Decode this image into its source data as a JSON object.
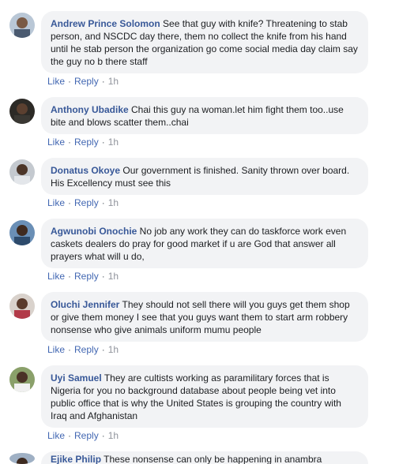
{
  "comments": [
    {
      "author": "Andrew Prince Solomon",
      "text": "See that guy with knife? Threatening to stab person, and NSCDC day there, them no collect the knife from his hand until he stab person the organization go come social media day claim say the guy no b there staff",
      "like": "Like",
      "reply": "Reply",
      "time": "1h"
    },
    {
      "author": "Anthony Ubadike",
      "text": "Chai this guy na woman.let him fight them too..use bite and blows scatter them..chai",
      "like": "Like",
      "reply": "Reply",
      "time": "1h"
    },
    {
      "author": "Donatus Okoye",
      "text": "Our government is finished. Sanity thrown over board. His Excellency must see this",
      "like": "Like",
      "reply": "Reply",
      "time": "1h"
    },
    {
      "author": "Agwunobi Onochie",
      "text": "No job any work they can do taskforce work even caskets dealers do pray for good market if u are God that answer all prayers what will u do,",
      "like": "Like",
      "reply": "Reply",
      "time": "1h"
    },
    {
      "author": "Oluchi Jennifer",
      "text": "They should not sell there will you guys get them shop or give them money I see that you guys want them to start arm robbery nonsense who give animals uniform mumu people",
      "like": "Like",
      "reply": "Reply",
      "time": "1h"
    },
    {
      "author": "Uyi Samuel",
      "text": "They are cultists working as paramilitary forces that is Nigeria for you no background database about people being vet into public office that is why the United States is grouping the country with Iraq and Afghanistan",
      "like": "Like",
      "reply": "Reply",
      "time": "1h"
    },
    {
      "author": "Ejike Philip",
      "text": "These nonsense can only be happening in anambra",
      "like": "",
      "reply": "",
      "time": ""
    }
  ],
  "colors": {
    "link": "#385898",
    "bubble": "#f2f3f5",
    "action": "#4267b2"
  }
}
